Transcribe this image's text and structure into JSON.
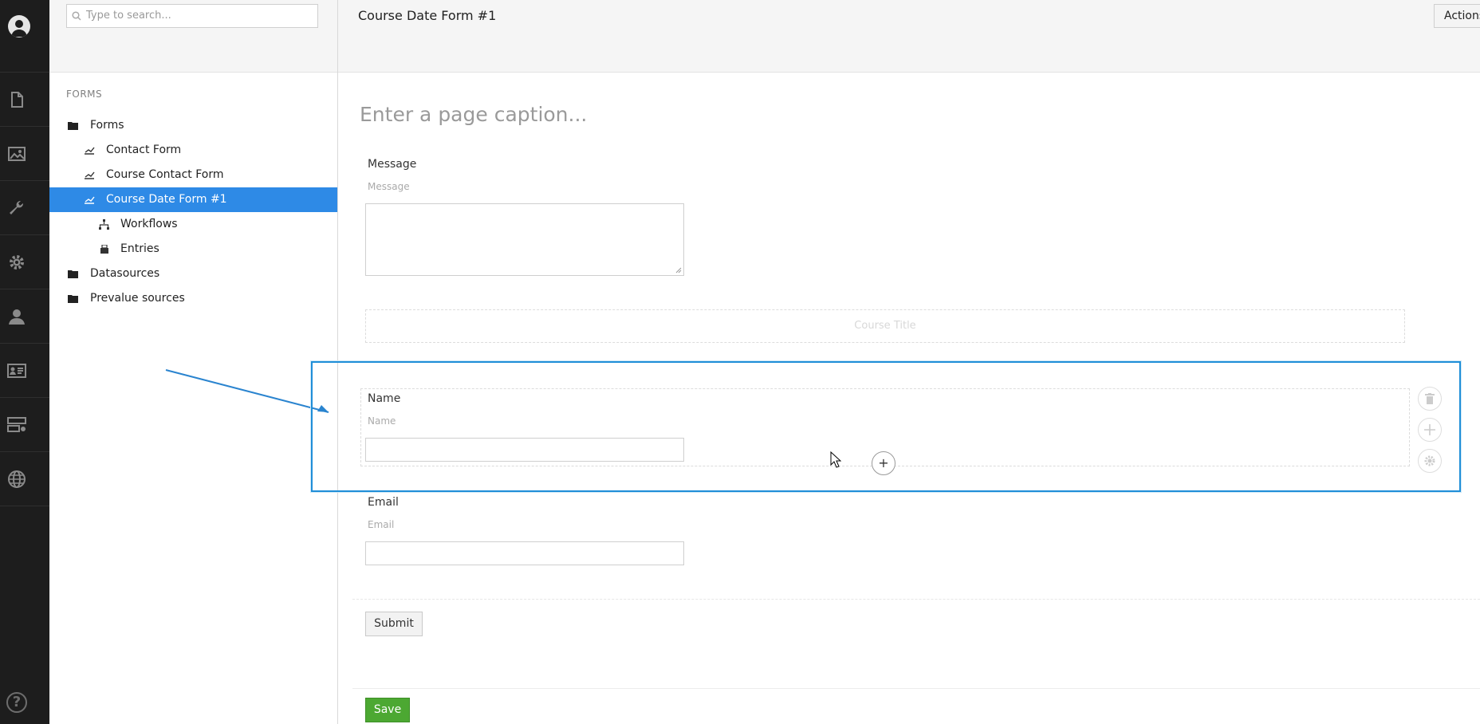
{
  "search": {
    "placeholder": "Type to search..."
  },
  "tree": {
    "section_title": "FORMS",
    "nodes": [
      {
        "label": "Forms",
        "icon": "folder-icon"
      },
      {
        "label": "Contact Form",
        "icon": "form-icon"
      },
      {
        "label": "Course Contact Form",
        "icon": "form-icon"
      },
      {
        "label": "Course Date Form #1",
        "icon": "form-icon",
        "active": true
      },
      {
        "label": "Workflows",
        "icon": "workflow-icon"
      },
      {
        "label": "Entries",
        "icon": "entries-icon"
      },
      {
        "label": "Datasources",
        "icon": "folder-icon"
      },
      {
        "label": "Prevalue sources",
        "icon": "folder-icon"
      }
    ]
  },
  "header": {
    "title": "Course Date Form #1",
    "actions_label": "Actions"
  },
  "page": {
    "caption_placeholder": "Enter a page caption..."
  },
  "fields": {
    "message": {
      "label": "Message",
      "caption": "Message"
    },
    "course_title": {
      "label": "Course Title"
    },
    "name": {
      "label": "Name",
      "caption": "Name"
    },
    "email": {
      "label": "Email",
      "caption": "Email"
    }
  },
  "buttons": {
    "submit_label": "Submit",
    "save_label": "Save"
  },
  "colors": {
    "accent": "#2e8ae6",
    "save": "#4ca832",
    "highlight": "#1f8ed8",
    "sidebar": "#1d1d1d"
  },
  "appbar_icons": [
    "document-icon",
    "media-icon",
    "wrench-icon",
    "gear-icon",
    "user-icon",
    "member-card-icon",
    "forms-icon",
    "globe-icon",
    "help-icon"
  ]
}
